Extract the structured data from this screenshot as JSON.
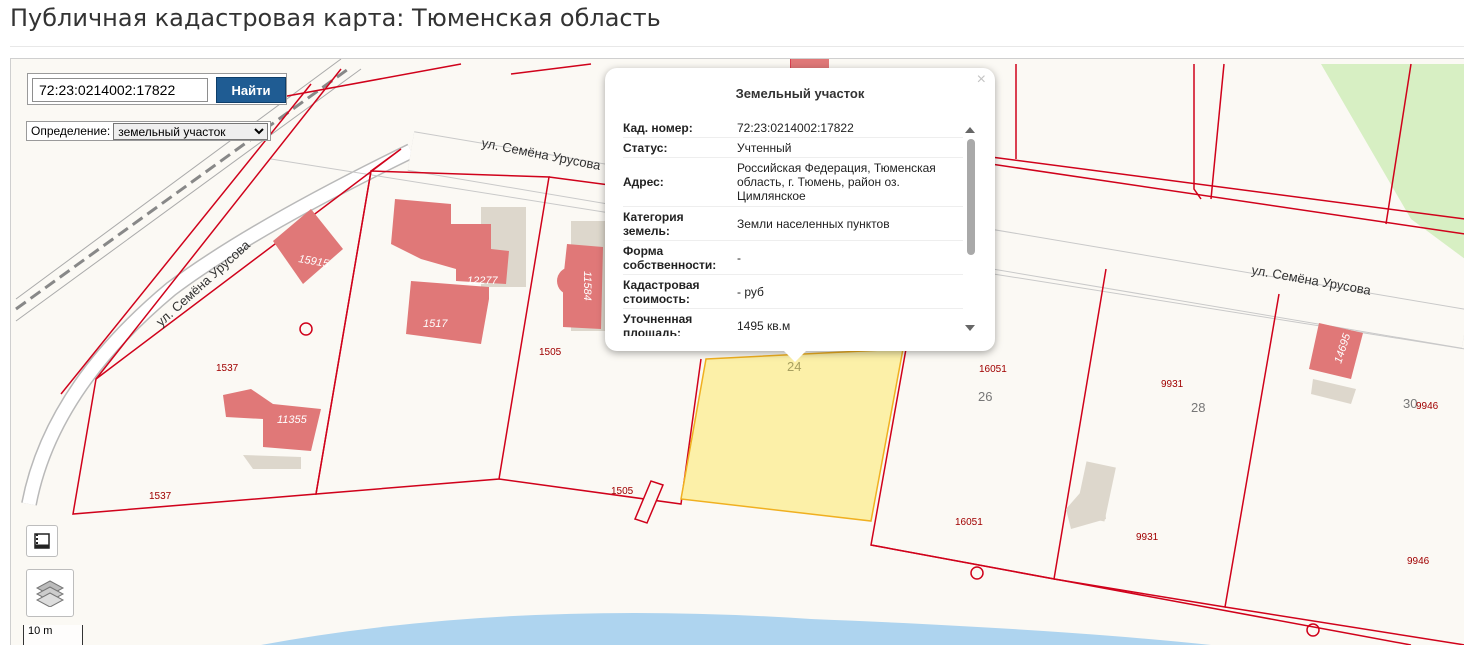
{
  "page": {
    "title": "Публичная кадастровая карта: Тюменская область"
  },
  "search": {
    "value": "72:23:0214002:17822",
    "button_label": "Найти"
  },
  "definition": {
    "label": "Определение:",
    "selected": "земельный участок"
  },
  "scale": {
    "label": "10 m"
  },
  "map": {
    "streets": [
      "ул. Семёна Урусова",
      "ул. Семёна Урусова",
      "ул. Семёна Урусова"
    ],
    "building_labels": [
      "15915",
      "12277",
      "1517",
      "11584",
      "11355",
      "14695"
    ],
    "parcel_labels": [
      "1537",
      "1537",
      "1505",
      "1505",
      "24",
      "16051",
      "16051",
      "26",
      "9931",
      "9931",
      "28",
      "30",
      "9946",
      "9946"
    ]
  },
  "popup": {
    "title": "Земельный участок",
    "close": "×",
    "rows": [
      {
        "key": "Кад. номер:",
        "value": "72:23:0214002:17822"
      },
      {
        "key": "Статус:",
        "value": "Учтенный"
      },
      {
        "key": "Адрес:",
        "value": "Российская Федерация, Тюменская область, г. Тюмень, район оз. Цимлянское"
      },
      {
        "key": "Категория земель:",
        "value": "Земли населенных пунктов"
      },
      {
        "key": "Форма собственности:",
        "value": "-"
      },
      {
        "key": "Кадастровая стоимость:",
        "value": "- руб"
      },
      {
        "key": "Уточненная площадь:",
        "value": "1495 кв.м"
      }
    ]
  },
  "colors": {
    "parcel_border": "#d0021b",
    "building": "#e07878",
    "highlight": "#fcf0a8",
    "button": "#1f5c93",
    "park": "#d7efc3",
    "water": "#aed4ef"
  }
}
